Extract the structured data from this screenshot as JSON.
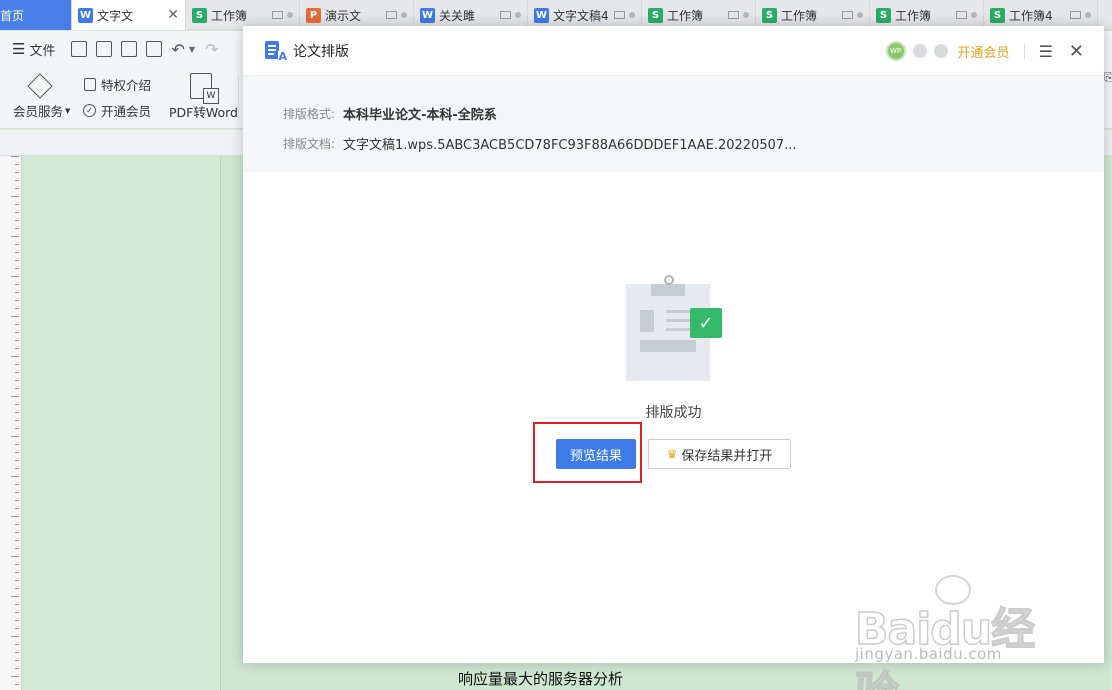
{
  "tabs": [
    {
      "label": "首页",
      "type": "home"
    },
    {
      "label": "文字文",
      "type": "w",
      "active": true,
      "closable": true
    },
    {
      "label": "工作簿",
      "type": "s"
    },
    {
      "label": "演示文",
      "type": "p"
    },
    {
      "label": "关关雎",
      "type": "w"
    },
    {
      "label": "文字文稿4",
      "type": "w"
    },
    {
      "label": "工作簿",
      "type": "s"
    },
    {
      "label": "工作簿",
      "type": "s"
    },
    {
      "label": "工作簿",
      "type": "s"
    },
    {
      "label": "工作簿4",
      "type": "s"
    }
  ],
  "menu": {
    "file_label": "文件"
  },
  "ribbon": {
    "member_service": "会员服务",
    "privilege_intro": "特权介绍",
    "open_member": "开通会员",
    "pdf_to_word": "PDF转Word"
  },
  "document": {
    "body_text": "响应量最大的服务器分析"
  },
  "dialog": {
    "title": "论文排版",
    "avatar_text": "WP",
    "vip_link": "开通会员",
    "format_key": "排版格式:",
    "format_value": "本科毕业论文-本科-全院系",
    "doc_key": "排版文档:",
    "doc_value": "文字文稿1.wps.5ABC3ACB5CD78FC93F88A66DDDEF1AAE.20220507...",
    "success_text": "排版成功",
    "preview_button": "预览结果",
    "save_button": "保存结果并打开"
  },
  "watermark": {
    "brand": "Baidu经验",
    "url": "jingyan.baidu.com"
  },
  "colors": {
    "accent": "#3e7ae8",
    "vip": "#e8a21a",
    "success": "#36b96b",
    "highlight": "#e02020",
    "doc_bg": "#d3e8d5"
  }
}
